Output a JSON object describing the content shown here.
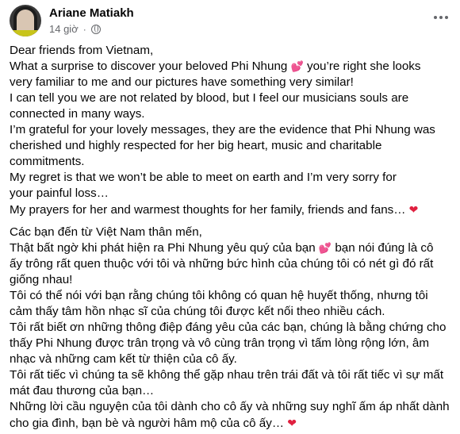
{
  "post": {
    "author": "Ariane Matiakh",
    "time": "14 giờ",
    "dot": "·",
    "english": {
      "l1": "Dear friends from Vietnam,",
      "l2a": "What a surprise to discover your beloved Phi Nhung ",
      "l2b": " you’re right she looks",
      "l3": "very familiar to me and our pictures have something very similar!",
      "l4": "I can tell you we are not related by blood, but I feel our musicians souls are",
      "l5": "connected in many ways.",
      "l6": "I’m grateful for your lovely messages, they are the evidence that Phi Nhung was",
      "l7": "cherished und highly respected for her big heart, music and charitable",
      "l8": "commitments.",
      "l9": "My regret is that we won’t be able to meet on earth and I’m very sorry for",
      "l10": "your painful loss…",
      "l11": "My prayers for her and warmest thoughts for her family, friends and fans… "
    },
    "vietnamese": {
      "l1": "Các bạn đến từ Việt Nam thân mến,",
      "l2a": "Thật bất ngờ khi phát hiện ra Phi Nhung yêu quý của bạn ",
      "l2b": " bạn nói đúng là cô",
      "l3": "ấy trông rất quen thuộc với tôi và những bức hình của chúng tôi có nét gì đó rất",
      "l4": "giống nhau!",
      "l5": "Tôi có thể nói với bạn rằng chúng tôi không có quan hệ huyết thống, nhưng tôi",
      "l6": "cảm thấy tâm hồn nhạc sĩ của chúng tôi được kết nối theo nhiều cách.",
      "l7": "Tôi rất biết ơn những thông điệp đáng yêu của các bạn, chúng là bằng chứng cho",
      "l8": "thấy Phi Nhung được trân trọng và vô cùng trân trọng vì tấm lòng rộng lớn, âm",
      "l9": "nhạc và những cam kết từ thiện của cô ấy.",
      "l10": "Tôi rất tiếc vì chúng ta sẽ không thể gặp nhau trên trái đất và tôi rất tiếc vì sự mất",
      "l11": "mát đau thương của bạn…",
      "l12": "Những lời cầu nguyện của tôi dành cho cô ấy và những suy nghĩ ấm áp nhất dành",
      "l13": "cho gia đình, bạn bè và người hâm mộ của cô ấy… "
    },
    "emoji": {
      "two_hearts": "💕",
      "red_heart": "❤"
    },
    "icons": {
      "audience": "globe-icon",
      "menu": "more-options-icon"
    },
    "colors": {
      "text": "#050505",
      "meta": "#65676b",
      "heart": "#e02040"
    }
  }
}
